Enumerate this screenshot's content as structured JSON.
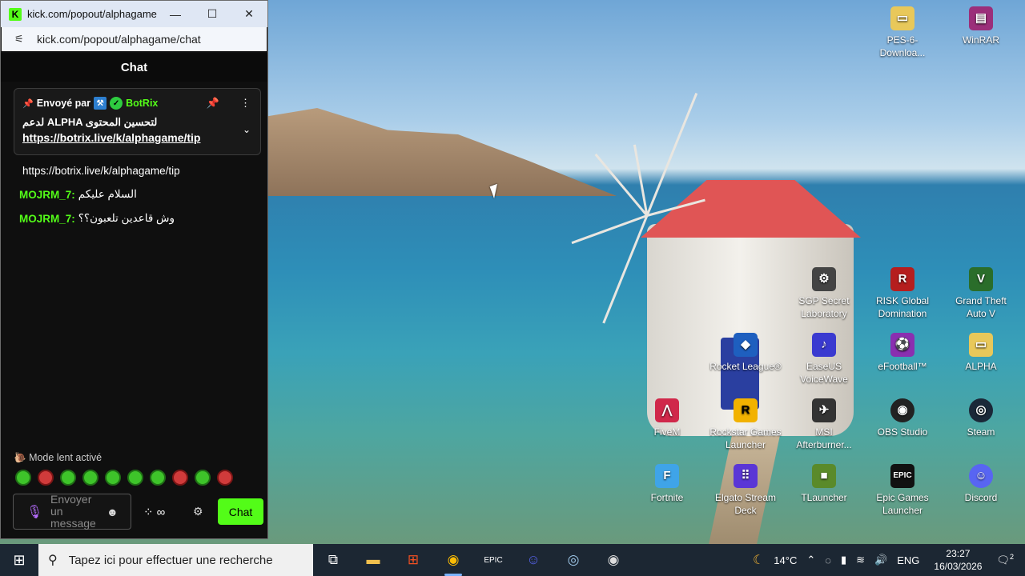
{
  "browser": {
    "title": "kick.com/popout/alphagame...",
    "url": "kick.com/popout/alphagame/chat",
    "minimize_icon": "minimize-icon",
    "maximize_icon": "maximize-icon",
    "close_icon": "close-icon"
  },
  "chat": {
    "header": "Chat",
    "pinned": {
      "sent_by": "Envoyé par",
      "bot_name": "BotRix",
      "message_line1": "لدعم ALPHA لتحسين المحتوى",
      "message_link": "https://botrix.live/k/alphagame/tip"
    },
    "messages": [
      {
        "user": "",
        "text": "https://botrix.live/k/alphagame/tip"
      },
      {
        "user": "MOJRM_7:",
        "text": "السلام عليكم"
      },
      {
        "user": "MOJRM_7:",
        "text": "وش قاعدين تلعبون؟؟"
      }
    ],
    "slow_mode": "Mode lent activé",
    "input_placeholder_1": "Envoyer",
    "input_placeholder_2": "un",
    "input_placeholder_3": "message",
    "infinity": "∞",
    "send_label": "Chat"
  },
  "desktop_icons": [
    {
      "label": "PES-6-Downloa...",
      "icon": "folder-icon",
      "color": "#e8c85a"
    },
    {
      "label": "WinRAR",
      "icon": "winrar-icon",
      "color": "#9b2f7a"
    },
    {
      "label": "SGP Secret Laboratory",
      "icon": "scp-icon",
      "color": "#444444"
    },
    {
      "label": "RISK Global Domination",
      "icon": "risk-icon",
      "color": "#b51e1e"
    },
    {
      "label": "Grand Theft Auto V",
      "icon": "gta-icon",
      "color": "#2a6d2a"
    },
    {
      "label": "Rocket League®",
      "icon": "rocket-league-icon",
      "color": "#1e5fbf"
    },
    {
      "label": "EaseUS VoiceWave",
      "icon": "voicewave-icon",
      "color": "#3a3ad0"
    },
    {
      "label": "eFootball™",
      "icon": "efootball-icon",
      "color": "#8a2fb0"
    },
    {
      "label": "ALPHA",
      "icon": "folder-icon",
      "color": "#e8c85a"
    },
    {
      "label": "FiveM",
      "icon": "fivem-icon",
      "color": "#d0284a"
    },
    {
      "label": "Rockstar Games Launcher",
      "icon": "rockstar-icon",
      "color": "#f2b200"
    },
    {
      "label": "MSI Afterburner...",
      "icon": "afterburner-icon",
      "color": "#333333"
    },
    {
      "label": "OBS Studio",
      "icon": "obs-icon",
      "color": "#222222"
    },
    {
      "label": "Steam",
      "icon": "steam-icon",
      "color": "#1b2838"
    },
    {
      "label": "Fortnite",
      "icon": "fortnite-icon",
      "color": "#3fa4e8"
    },
    {
      "label": "Elgato Stream Deck",
      "icon": "stream-deck-icon",
      "color": "#5a36d6"
    },
    {
      "label": "TLauncher",
      "icon": "tlauncher-icon",
      "color": "#5a8a2a"
    },
    {
      "label": "Epic Games Launcher",
      "icon": "epic-icon",
      "color": "#111111"
    },
    {
      "label": "Discord",
      "icon": "discord-icon",
      "color": "#5865f2"
    }
  ],
  "taskbar": {
    "search_placeholder": "Tapez ici pour effectuer une recherche",
    "temperature": "14°C",
    "language": "ENG",
    "time": "23:27",
    "date": "16/03/2026",
    "notifications": "2"
  }
}
